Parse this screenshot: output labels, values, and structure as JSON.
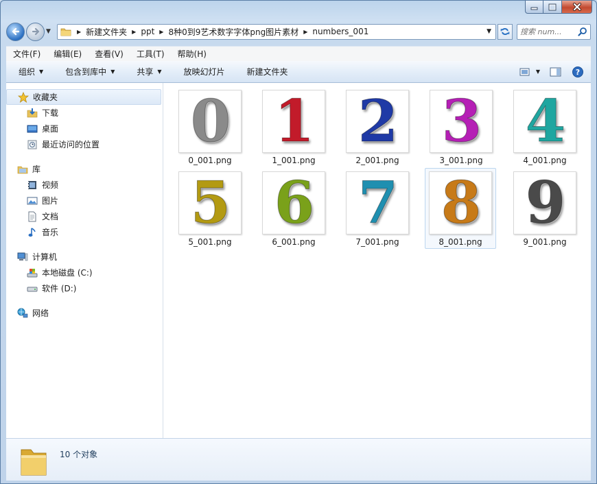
{
  "window": {
    "caption_buttons": {
      "minimize": "minimize",
      "maximize": "maximize",
      "close": "close"
    }
  },
  "address_bar": {
    "breadcrumbs": [
      {
        "label": "新建文件夹"
      },
      {
        "label": "ppt"
      },
      {
        "label": "8种0到9艺术数字字体png图片素材"
      },
      {
        "label": "numbers_001"
      }
    ],
    "search_placeholder": "搜索 num..."
  },
  "menu": [
    "文件(F)",
    "编辑(E)",
    "查看(V)",
    "工具(T)",
    "帮助(H)"
  ],
  "toolbar": {
    "organize": "组织",
    "include_in_library": "包含到库中",
    "share": "共享",
    "slideshow": "放映幻灯片",
    "new_folder": "新建文件夹"
  },
  "sidebar": {
    "favorites": {
      "label": "收藏夹",
      "items": [
        "下载",
        "桌面",
        "最近访问的位置"
      ]
    },
    "libraries": {
      "label": "库",
      "items": [
        "视频",
        "图片",
        "文档",
        "音乐"
      ]
    },
    "computer": {
      "label": "计算机",
      "items": [
        "本地磁盘 (C:)",
        "软件 (D:)"
      ]
    },
    "network": {
      "label": "网络"
    }
  },
  "files": [
    {
      "name": "0_001.png",
      "glyph": "0",
      "color": "#8a8a8a"
    },
    {
      "name": "1_001.png",
      "glyph": "1",
      "color": "#c21b2a"
    },
    {
      "name": "2_001.png",
      "glyph": "2",
      "color": "#1f3aa6"
    },
    {
      "name": "3_001.png",
      "glyph": "3",
      "color": "#b51fb5"
    },
    {
      "name": "4_001.png",
      "glyph": "4",
      "color": "#1fa6a0"
    },
    {
      "name": "5_001.png",
      "glyph": "5",
      "color": "#b39a12"
    },
    {
      "name": "6_001.png",
      "glyph": "6",
      "color": "#7aa11a"
    },
    {
      "name": "7_001.png",
      "glyph": "7",
      "color": "#1f8fb0"
    },
    {
      "name": "8_001.png",
      "glyph": "8",
      "color": "#c77a18"
    },
    {
      "name": "9_001.png",
      "glyph": "9",
      "color": "#4a4a4a"
    }
  ],
  "status": {
    "count_text": "10 个对象"
  }
}
